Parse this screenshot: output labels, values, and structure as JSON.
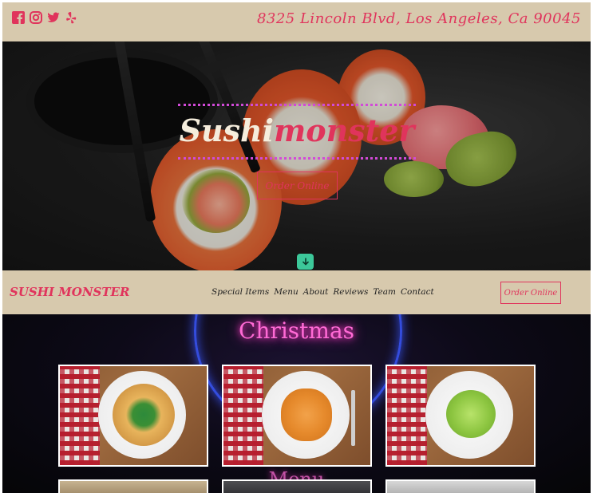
{
  "topbar": {
    "social": [
      {
        "icon": "facebook-icon"
      },
      {
        "icon": "instagram-icon"
      },
      {
        "icon": "twitter-icon"
      },
      {
        "icon": "yelp-icon"
      }
    ],
    "address": "8325 Lincoln Blvd, Los Angeles, Ca 90045"
  },
  "hero": {
    "brand_part1": "Sushi",
    "brand_part2": "monster",
    "order_label": "Order Online",
    "scroll_icon": "arrow-down-icon"
  },
  "nav": {
    "logo": "SUSHI MONSTER",
    "links": [
      "Special Items",
      "Menu",
      "About",
      "Reviews",
      "Team",
      "Contact"
    ],
    "order_label": "Order Online"
  },
  "section": {
    "title": "Christmas",
    "subtitle": "Menu"
  },
  "colors": {
    "accent": "#e0345c",
    "bar": "#d7c9ad",
    "neon_pink": "#ff6ad5",
    "neon_blue": "#3a58ff",
    "scroll_button": "#3cc89a"
  }
}
